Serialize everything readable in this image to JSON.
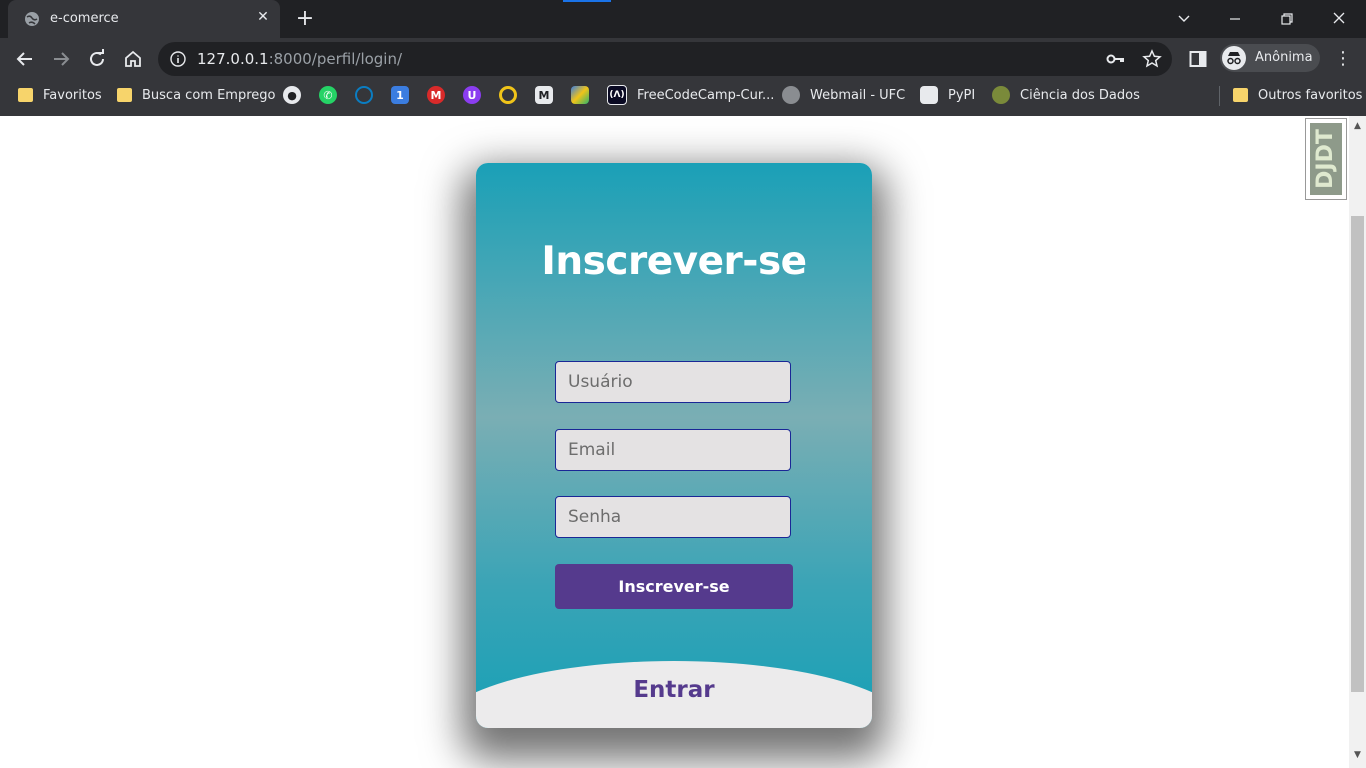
{
  "browser": {
    "tab_title": "e-comerce",
    "new_tab_symbol": "+",
    "url_host": "127.0.0.1",
    "url_rest": ":8000/perfil/login/",
    "profile_name": "Anônima",
    "bookmarks": [
      {
        "label": "Favoritos",
        "icon": "folder-icon"
      },
      {
        "label": "Busca com Emprego",
        "icon": "folder-icon"
      },
      {
        "label": "",
        "icon": "github-icon"
      },
      {
        "label": "",
        "icon": "whatsapp-icon"
      },
      {
        "label": "",
        "icon": "dell-icon"
      },
      {
        "label": "",
        "icon": "calendar-icon"
      },
      {
        "label": "",
        "icon": "gmail-icon"
      },
      {
        "label": "",
        "icon": "shield-icon"
      },
      {
        "label": "",
        "icon": "ring-icon"
      },
      {
        "label": "",
        "icon": "m-icon"
      },
      {
        "label": "",
        "icon": "code-icon"
      },
      {
        "label": "FreeCodeCamp-Cur...",
        "icon": "freecodecamp-icon"
      },
      {
        "label": "Webmail - UFC",
        "icon": "globe-icon"
      },
      {
        "label": "PyPI",
        "icon": "pypi-icon"
      },
      {
        "label": "Ciência dos Dados",
        "icon": "brain-icon"
      },
      {
        "label": "Outros favoritos",
        "icon": "folder-icon"
      }
    ]
  },
  "card": {
    "title": "Inscrever-se",
    "username_placeholder": "Usuário",
    "email_placeholder": "Email",
    "password_placeholder": "Senha",
    "submit_label": "Inscrever-se",
    "switch_label": "Entrar"
  },
  "debug_toolbar": {
    "label": "DJDT"
  },
  "colors": {
    "card_top": "#1aa0b7",
    "card_mid": "#7aaeb4",
    "submit_bg": "#553a8d",
    "field_border": "#1a2796",
    "field_bg": "#e4e2e3",
    "bottom_bg": "#ecebec"
  }
}
